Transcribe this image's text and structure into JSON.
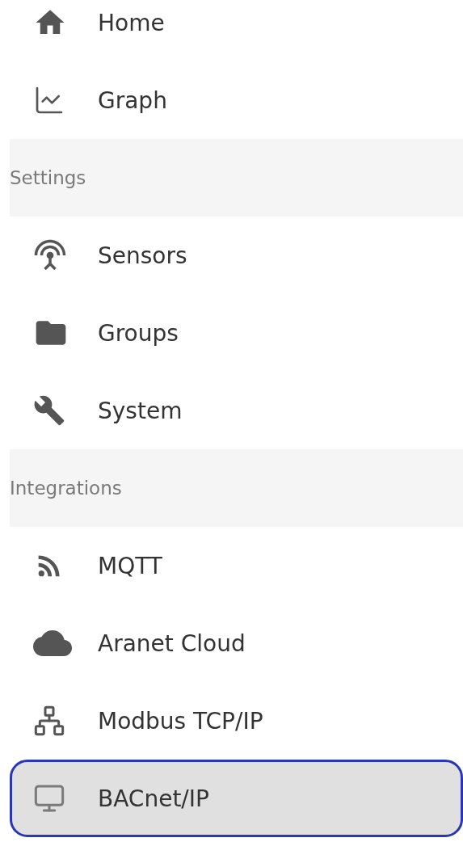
{
  "nav": [
    {
      "kind": "item",
      "label": "Home",
      "selected": false
    },
    {
      "kind": "item",
      "label": "Graph",
      "selected": false
    },
    {
      "kind": "header",
      "label": "Settings"
    },
    {
      "kind": "item",
      "label": "Sensors",
      "selected": false
    },
    {
      "kind": "item",
      "label": "Groups",
      "selected": false
    },
    {
      "kind": "item",
      "label": "System",
      "selected": false
    },
    {
      "kind": "header",
      "label": "Integrations"
    },
    {
      "kind": "item",
      "label": "MQTT",
      "selected": false
    },
    {
      "kind": "item",
      "label": "Aranet Cloud",
      "selected": false
    },
    {
      "kind": "item",
      "label": "Modbus TCP/IP",
      "selected": false
    },
    {
      "kind": "item",
      "label": "BACnet/IP",
      "selected": true
    }
  ]
}
